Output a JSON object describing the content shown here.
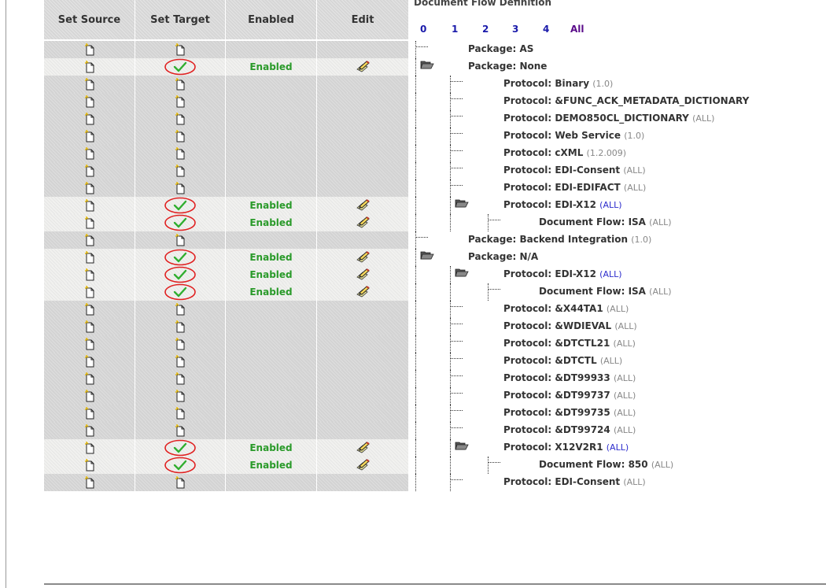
{
  "table": {
    "headers": {
      "set_source": "Set Source",
      "set_target": "Set Target",
      "enabled": "Enabled",
      "edit": "Edit"
    },
    "enabled_label": "Enabled"
  },
  "flow": {
    "title": "Document Flow Definition",
    "levels": [
      "0",
      "1",
      "2",
      "3",
      "4",
      "All"
    ],
    "rows": [
      {
        "label": "Package: AS",
        "version": "",
        "enabled": false,
        "link": false
      },
      {
        "label": "Package: None",
        "version": "",
        "enabled": true,
        "link": false
      },
      {
        "label": "Protocol: Binary",
        "version": "(1.0)",
        "enabled": false,
        "link": false
      },
      {
        "label": "Protocol: &FUNC_ACK_METADATA_DICTIONARY",
        "version": "",
        "enabled": false,
        "link": false
      },
      {
        "label": "Protocol: DEMO850CL_DICTIONARY",
        "version": "(ALL)",
        "enabled": false,
        "link": false
      },
      {
        "label": "Protocol: Web Service",
        "version": "(1.0)",
        "enabled": false,
        "link": false
      },
      {
        "label": "Protocol: cXML",
        "version": "(1.2.009)",
        "enabled": false,
        "link": false
      },
      {
        "label": "Protocol: EDI-Consent",
        "version": "(ALL)",
        "enabled": false,
        "link": false
      },
      {
        "label": "Protocol: EDI-EDIFACT",
        "version": "(ALL)",
        "enabled": false,
        "link": false
      },
      {
        "label": "Protocol: EDI-X12",
        "version": "(ALL)",
        "enabled": true,
        "link": true
      },
      {
        "label": "Document Flow: ISA",
        "version": "(ALL)",
        "enabled": true,
        "link": false
      },
      {
        "label": "Package: Backend Integration",
        "version": "(1.0)",
        "enabled": false,
        "link": false
      },
      {
        "label": "Package: N/A",
        "version": "",
        "enabled": true,
        "link": false
      },
      {
        "label": "Protocol: EDI-X12",
        "version": "(ALL)",
        "enabled": true,
        "link": true
      },
      {
        "label": "Document Flow: ISA",
        "version": "(ALL)",
        "enabled": true,
        "link": false
      },
      {
        "label": "Protocol: &X44TA1",
        "version": "(ALL)",
        "enabled": false,
        "link": false
      },
      {
        "label": "Protocol: &WDIEVAL",
        "version": "(ALL)",
        "enabled": false,
        "link": false
      },
      {
        "label": "Protocol: &DTCTL21",
        "version": "(ALL)",
        "enabled": false,
        "link": false
      },
      {
        "label": "Protocol: &DTCTL",
        "version": "(ALL)",
        "enabled": false,
        "link": false
      },
      {
        "label": "Protocol: &DT99933",
        "version": "(ALL)",
        "enabled": false,
        "link": false
      },
      {
        "label": "Protocol: &DT99737",
        "version": "(ALL)",
        "enabled": false,
        "link": false
      },
      {
        "label": "Protocol: &DT99735",
        "version": "(ALL)",
        "enabled": false,
        "link": false
      },
      {
        "label": "Protocol: &DT99724",
        "version": "(ALL)",
        "enabled": false,
        "link": false
      },
      {
        "label": "Protocol: X12V2R1",
        "version": "(ALL)",
        "enabled": true,
        "link": true
      },
      {
        "label": "Document Flow: 850",
        "version": "(ALL)",
        "enabled": true,
        "link": false
      },
      {
        "label": "Protocol: EDI-Consent",
        "version": "(ALL)",
        "enabled": false,
        "link": false
      }
    ]
  },
  "icons": {
    "set_source": "new-document-icon",
    "set_target_enabled": "checkmark-circle-icon",
    "set_target_disabled": "new-document-icon",
    "edit": "edit-pencil-icon",
    "folder": "open-folder-icon"
  },
  "colors": {
    "enabled_text": "#2a9a2a",
    "check_ring": "#e02020",
    "check_mark": "#2fae2f",
    "level_link": "#1a1aaa",
    "all_link": "#5a0c8a"
  }
}
